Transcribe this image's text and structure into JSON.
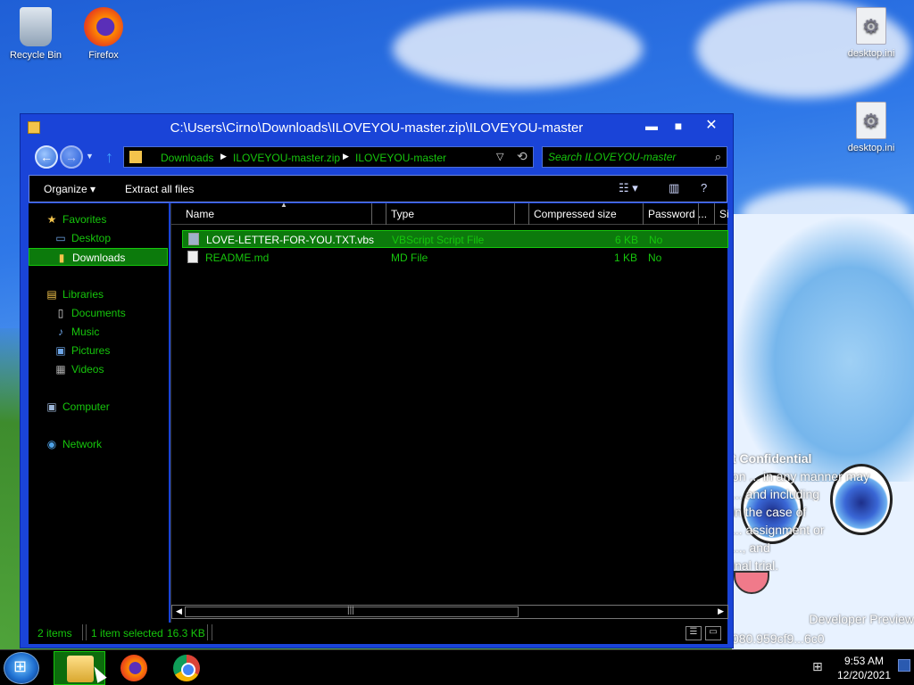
{
  "desktop": {
    "icons": [
      {
        "label": "Recycle Bin",
        "icon": "recycle-bin-icon"
      },
      {
        "label": "Firefox",
        "icon": "firefox-icon"
      },
      {
        "label": "desktop.ini",
        "icon": "settings-file-icon"
      },
      {
        "label": "desktop.ini",
        "icon": "settings-file-icon"
      }
    ],
    "watermark": {
      "line1": "t Confidential",
      "line2": "on ... in any manner may",
      "line3": "... and including",
      "line4": "in the case of",
      "line5": "... assignment or",
      "line6": "..., and",
      "line7": "inal trial.",
      "line8": "Developer Preview",
      "line9": "080.959cf9...6c0"
    }
  },
  "window": {
    "title": "C:\\Users\\Cirno\\Downloads\\ILOVEYOU-master.zip\\ILOVEYOU-master",
    "controls": {
      "minimize": "▬",
      "maximize": "■",
      "close": "✕"
    },
    "address": {
      "crumbs": [
        "Downloads",
        "ILOVEYOU-master.zip",
        "ILOVEYOU-master"
      ]
    },
    "search": {
      "placeholder": "Search ILOVEYOU-master"
    },
    "toolbar": {
      "organize": "Organize ▾",
      "extract": "Extract all files"
    },
    "nav": {
      "favorites": "Favorites",
      "desktop": "Desktop",
      "downloads": "Downloads",
      "libraries": "Libraries",
      "documents": "Documents",
      "music": "Music",
      "pictures": "Pictures",
      "videos": "Videos",
      "computer": "Computer",
      "network": "Network"
    },
    "columns": {
      "name": "Name",
      "type": "Type",
      "compressed": "Compressed size",
      "password": "Password ...",
      "size": "Si"
    },
    "files": [
      {
        "name": "LOVE-LETTER-FOR-YOU.TXT.vbs",
        "type": "VBScript Script File",
        "size": "6 KB",
        "password": "No"
      },
      {
        "name": "README.md",
        "type": "MD File",
        "size": "1 KB",
        "password": "No"
      }
    ],
    "status": {
      "count": "2 items",
      "selected": "1 item selected",
      "selected_size": "16.3 KB"
    }
  },
  "taskbar": {
    "time": "9:53 AM",
    "date": "12/20/2021"
  },
  "colors": {
    "window_frame": "#1a44d8",
    "text_green": "#16c60c",
    "selection": "#0c7a0c"
  }
}
